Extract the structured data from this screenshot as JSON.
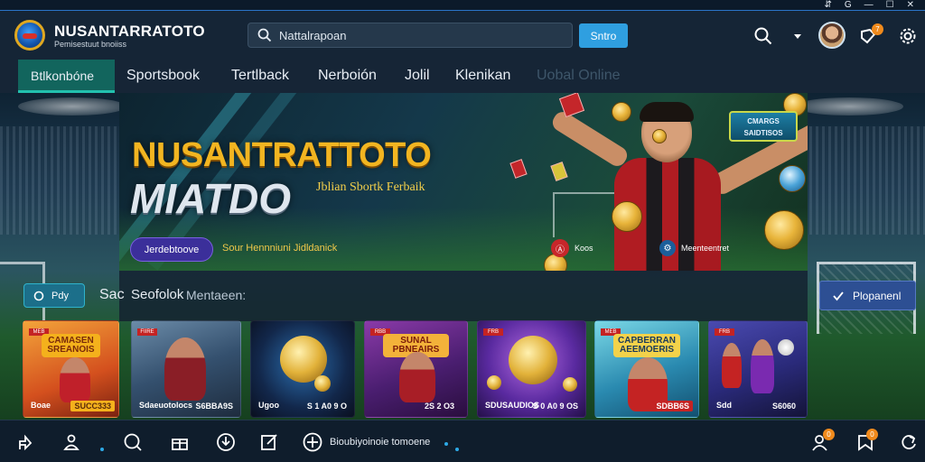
{
  "window_controls": {
    "icons": [
      "share-icon",
      "g-icon",
      "minimize-icon",
      "maximize-icon",
      "close-icon"
    ],
    "labels": [
      "⇵",
      "G",
      "—",
      "☐",
      "✕"
    ]
  },
  "header": {
    "brand": "NUSANTARRATOTO",
    "brand_sub": "Pemisestuut bnoiiss",
    "search_value": "Nattalrapoan",
    "search_button": "Sntro",
    "notif_badge": "7"
  },
  "nav": {
    "items": [
      {
        "label": "Btlkonbóne",
        "active": true
      },
      {
        "label": "Sportsbook",
        "active": false
      },
      {
        "label": "Tertlback",
        "active": false
      },
      {
        "label": "Nerboión",
        "active": false
      },
      {
        "label": "Jolil",
        "active": false
      },
      {
        "label": "Klenikan",
        "active": false
      },
      {
        "label": "Uobal Online",
        "active": false,
        "faded": true
      }
    ]
  },
  "hero": {
    "title_line1": "NUSANTRATTOTO",
    "title_line2": "MIATDO",
    "tagline": "Jblian Sbortk Ferbaik",
    "cta": "Jerdebtoove",
    "subtext": "Sour Hennniuni Jidldanick",
    "promo_badge_line1": "CMARGS",
    "promo_badge_line2": "SAIDTISOS",
    "chip1_label": "Koos",
    "chip2_label": "Meenteentret",
    "chip1_icon": "Ⓐ",
    "chip2_icon": "⚙"
  },
  "section": {
    "play_button": "Pdy",
    "cut_label": "Sac",
    "title": "Seofolok",
    "subtitle": "Mentaeen:",
    "right_button": "Plopanenl"
  },
  "games": [
    {
      "tag": "MEB",
      "ribbon": "CAMASEN\nSREANOIS",
      "name": "Boae",
      "value": "SUCC333",
      "ribbon_color": "#f4b11c"
    },
    {
      "tag": "FIIRE",
      "ribbon": "",
      "name": "Sdaeuotolocs",
      "value": "S6BBA9S",
      "ribbon_color": ""
    },
    {
      "tag": "",
      "ribbon": "",
      "name": "Ugoo",
      "value": "S 1 A0 9 O",
      "ribbon_color": ""
    },
    {
      "tag": "RBB",
      "ribbon": "SUNAL\nPBNEAIRS",
      "name": "",
      "value": "2S 2 O3",
      "ribbon_color": "#f3b23a"
    },
    {
      "tag": "FRB",
      "ribbon": "",
      "name": "SDUSAUDIOS",
      "value": "S 0 A0 9 OS",
      "ribbon_color": ""
    },
    {
      "tag": "MEB",
      "ribbon": "CAPBERRAN\nAEEMOERIS",
      "name": "",
      "value": "SDBB6S",
      "ribbon_color": "#f3d24a"
    },
    {
      "tag": "FRB",
      "ribbon": "",
      "name": "Sdd",
      "value": "S6060",
      "ribbon_color": ""
    }
  ],
  "bottombar": {
    "text": "Bioubiyoinoie tomoene",
    "badge1": "0",
    "badge2": "0"
  },
  "colors": {
    "accent": "#22c0ae",
    "primary_button": "#2f9fe0",
    "hero_gold": "#f2b521"
  }
}
